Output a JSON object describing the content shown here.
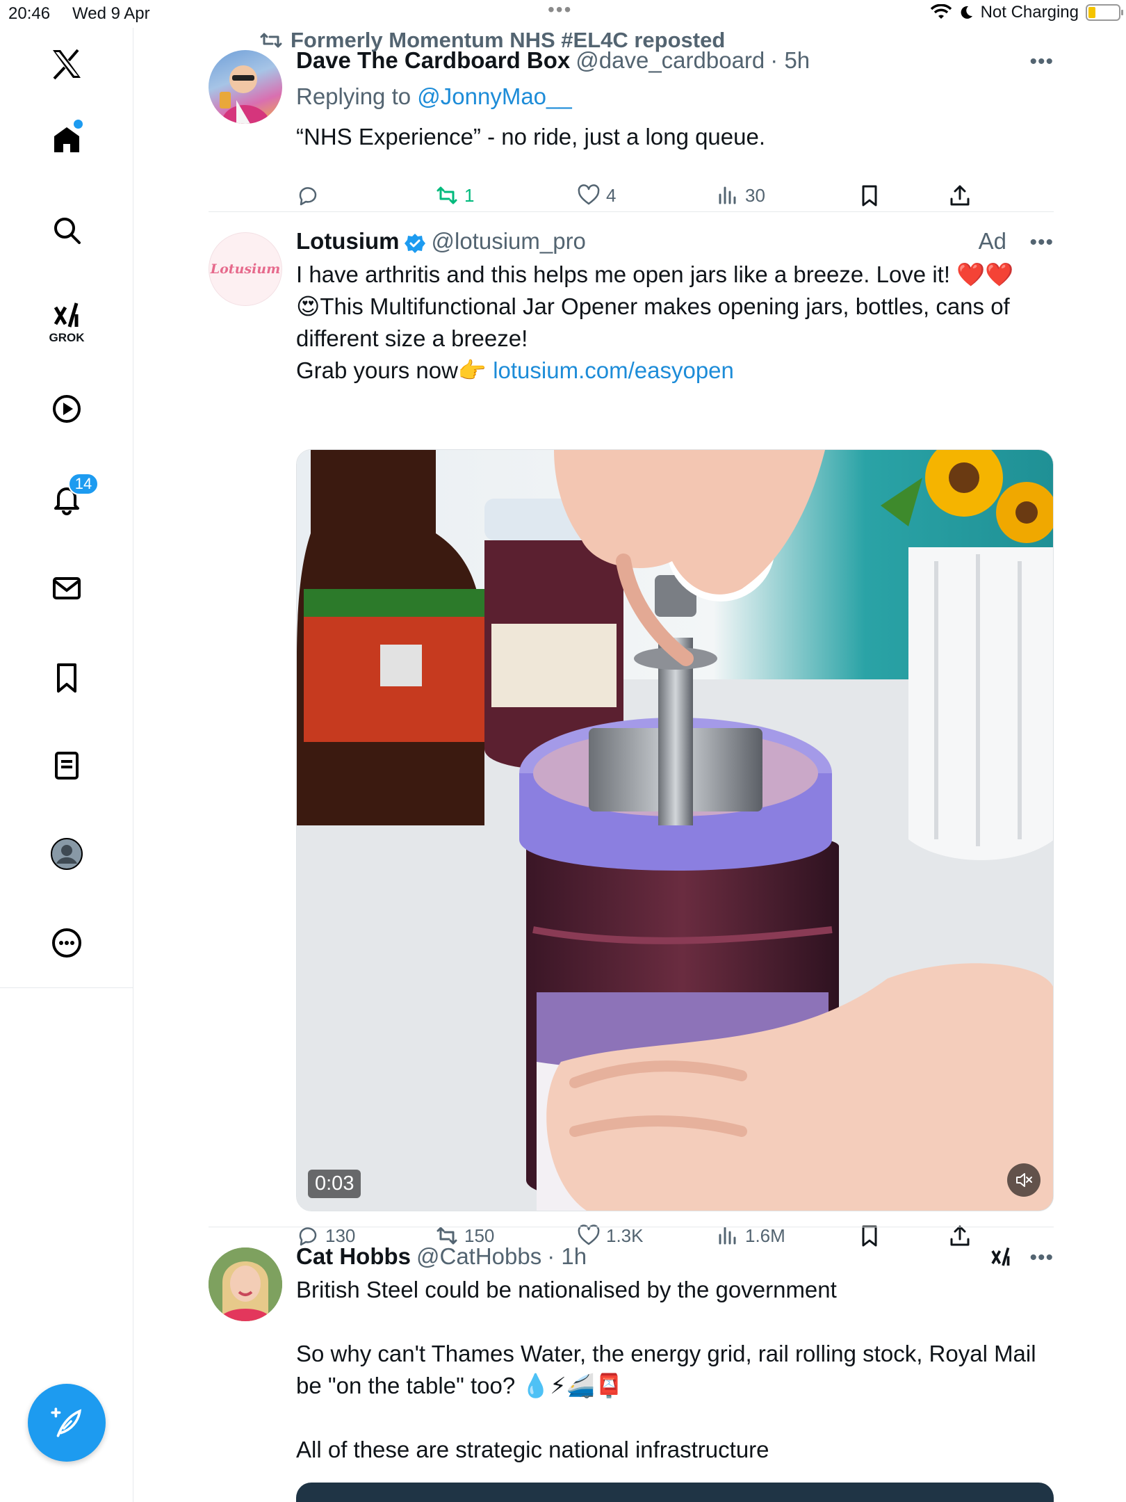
{
  "status_bar": {
    "time": "20:46",
    "date": "Wed 9 Apr",
    "dots": "•••",
    "charging": "Not Charging",
    "battery_percent": 10
  },
  "sidebar": {
    "logo": "X",
    "grok_label": "GROK",
    "notifications_badge": "14",
    "items": [
      {
        "icon": "home-icon"
      },
      {
        "icon": "search-icon"
      },
      {
        "icon": "grok-icon"
      },
      {
        "icon": "video-icon"
      },
      {
        "icon": "bell-icon"
      },
      {
        "icon": "mail-icon"
      },
      {
        "icon": "bookmark-icon"
      },
      {
        "icon": "lists-icon"
      },
      {
        "icon": "profile-icon"
      },
      {
        "icon": "more-icon"
      }
    ],
    "compose_icon": "compose-icon"
  },
  "tweets": [
    {
      "repost_note": "Formerly Momentum NHS #EL4C reposted",
      "name": "Dave The Cardboard Box",
      "handle": "@dave_cardboard",
      "time": "· 5h",
      "replying_prefix": "Replying to",
      "replying_handle": "@JonnyMao__",
      "text": "“NHS Experience” - no ride, just a long queue.",
      "replies": "",
      "retweets": "1",
      "likes": "4",
      "views": "30"
    },
    {
      "name": "Lotusium",
      "handle": "@lotusium_pro",
      "ad_label": "Ad",
      "avatar_text": "Lotusium",
      "text_lines": [
        "I have arthritis and this helps me open jars like a breeze. Love it! ❤️❤️",
        "😍This Multifunctional Jar Opener makes opening jars, bottles, cans of different size a breeze!"
      ],
      "text_grab": "Grab yours now👉",
      "link": "lotusium.com/easyopen",
      "video_duration": "0:03",
      "replies": "130",
      "retweets": "150",
      "likes": "1.3K",
      "views": "1.6M"
    },
    {
      "name": "Cat Hobbs",
      "handle": "@CatHobbs",
      "time": "· 1h",
      "text_1": "British Steel could be nationalised by the government",
      "text_2": "So why can't Thames Water, the energy grid, rail rolling stock, Royal Mail be \"on the table\" too? 💧⚡🚄📮",
      "text_3": "All of these are strategic national infrastructure"
    }
  ],
  "colors": {
    "accent": "#1d9bf0",
    "text": "#0f1419",
    "secondary": "#536471",
    "retweet_green": "#00ba7c",
    "divider": "#e6e9ec"
  }
}
